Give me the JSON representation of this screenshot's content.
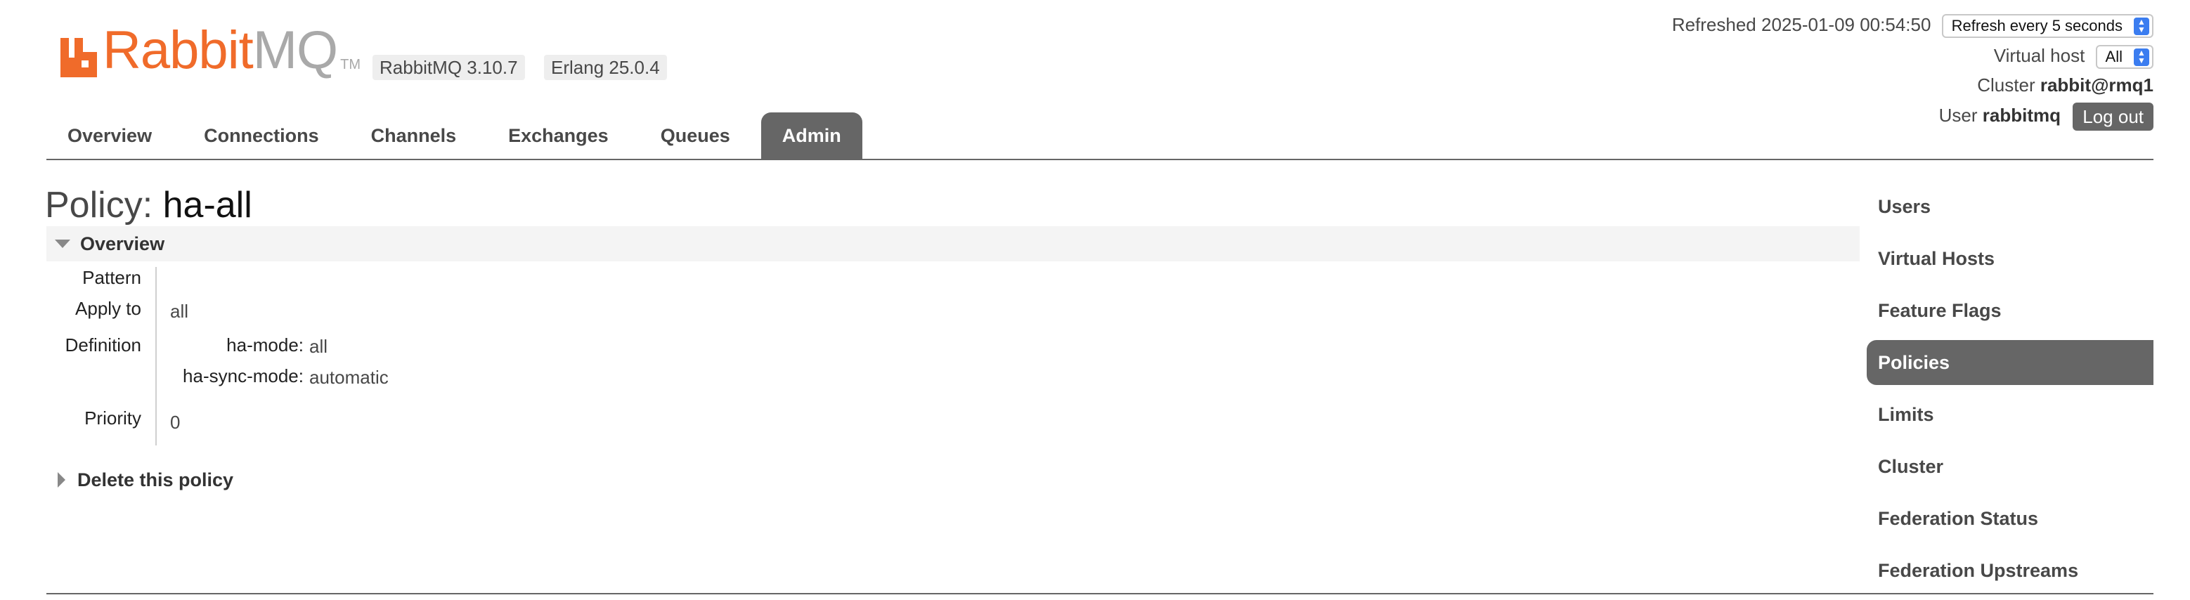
{
  "brand": {
    "logo_text_1": "Rabbit",
    "logo_text_2": "MQ",
    "logo_tm": "TM",
    "colors": {
      "primary": "#f06b2a",
      "secondary": "#a9a9a9"
    }
  },
  "versions": {
    "rabbitmq": "RabbitMQ 3.10.7",
    "erlang": "Erlang 25.0.4"
  },
  "status": {
    "refreshed_label": "Refreshed 2025-01-09 00:54:50",
    "refresh_select": "Refresh every 5 seconds",
    "vhost_label": "Virtual host",
    "vhost_select": "All",
    "cluster_label": "Cluster",
    "cluster_name": "rabbit@rmq1",
    "user_label": "User",
    "user_name": "rabbitmq",
    "logout_label": "Log out"
  },
  "tabs": [
    {
      "label": "Overview",
      "active": false
    },
    {
      "label": "Connections",
      "active": false
    },
    {
      "label": "Channels",
      "active": false
    },
    {
      "label": "Exchanges",
      "active": false
    },
    {
      "label": "Queues",
      "active": false
    },
    {
      "label": "Admin",
      "active": true
    }
  ],
  "page": {
    "title_prefix": "Policy:",
    "title_name": "ha-all"
  },
  "overview": {
    "section_label": "Overview",
    "pattern_label": "Pattern",
    "pattern_value": "",
    "apply_to_label": "Apply to",
    "apply_to_value": "all",
    "definition_label": "Definition",
    "definition": [
      {
        "key": "ha-mode:",
        "value": "all"
      },
      {
        "key": "ha-sync-mode:",
        "value": "automatic"
      }
    ],
    "priority_label": "Priority",
    "priority_value": "0"
  },
  "delete_section": {
    "label": "Delete this policy"
  },
  "sidebar": {
    "items": [
      {
        "label": "Users",
        "active": false
      },
      {
        "label": "Virtual Hosts",
        "active": false
      },
      {
        "label": "Feature Flags",
        "active": false
      },
      {
        "label": "Policies",
        "active": true
      },
      {
        "label": "Limits",
        "active": false
      },
      {
        "label": "Cluster",
        "active": false
      },
      {
        "label": "Federation Status",
        "active": false
      },
      {
        "label": "Federation Upstreams",
        "active": false
      }
    ]
  },
  "icons": {
    "logo": "rabbitmq-logo-icon",
    "select_arrows": "updown-arrows-icon",
    "expand_open": "triangle-down-icon",
    "expand_closed": "triangle-right-icon"
  }
}
